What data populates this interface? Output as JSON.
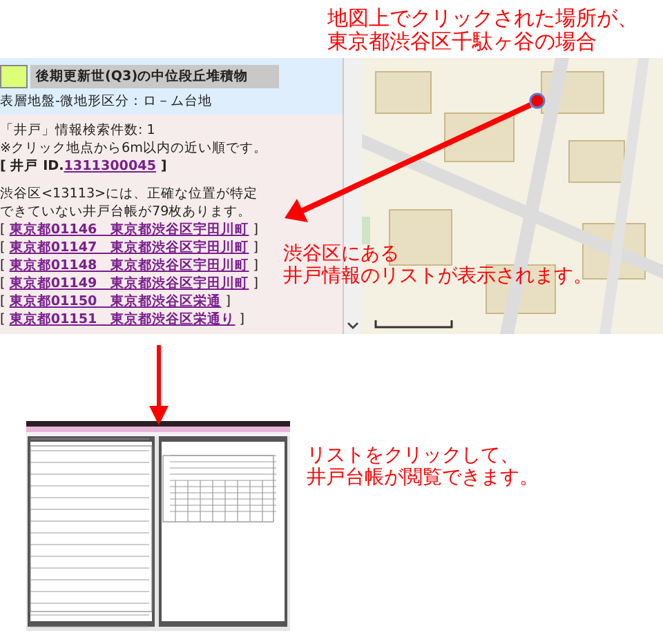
{
  "callout_top": {
    "lines": [
      "地図上でクリックされた場所が、",
      "東京都渋谷区千駄ヶ谷の場合"
    ]
  },
  "panel": {
    "legend": {
      "color": "#ddff77",
      "title": "後期更新世(Q3)の中位段丘堆積物"
    },
    "classification": "表層地盤-微地形区分：ロ－ム台地",
    "result_count": "「井戸」情報検索件数: 1",
    "note": "※クリック地点から6m以内の近い順です。",
    "well_id": {
      "prefix": "[ 井戸 ID.",
      "link": "1311300045",
      "suffix": "]"
    },
    "ward_note": "渋谷区<13113>には、正確な位置が特定できていない井戸台帳が79枚あります。",
    "wells": [
      {
        "open": "[",
        "link": "東京都01146　東京都渋谷区宇田川町",
        "close": "]"
      },
      {
        "open": "[",
        "link": "東京都01147　東京都渋谷区宇田川町",
        "close": "]"
      },
      {
        "open": "[",
        "link": "東京都01148　東京都渋谷区宇田川町",
        "close": "]"
      },
      {
        "open": "[",
        "link": "東京都01149　東京都渋谷区宇田川町",
        "close": "]"
      },
      {
        "open": "[",
        "link": "東京都01150　東京都渋谷区栄通",
        "close": "]"
      },
      {
        "open": "[",
        "link": "東京都01151　東京都渋谷区栄通り",
        "close": "]"
      }
    ]
  },
  "callout_middle": {
    "lines": [
      "渋谷区にある",
      "井戸情報のリストが表示されます。"
    ]
  },
  "callout_bottom": {
    "lines": [
      "リストをクリックして、",
      "井戸台帳が閲覧できます。"
    ]
  }
}
